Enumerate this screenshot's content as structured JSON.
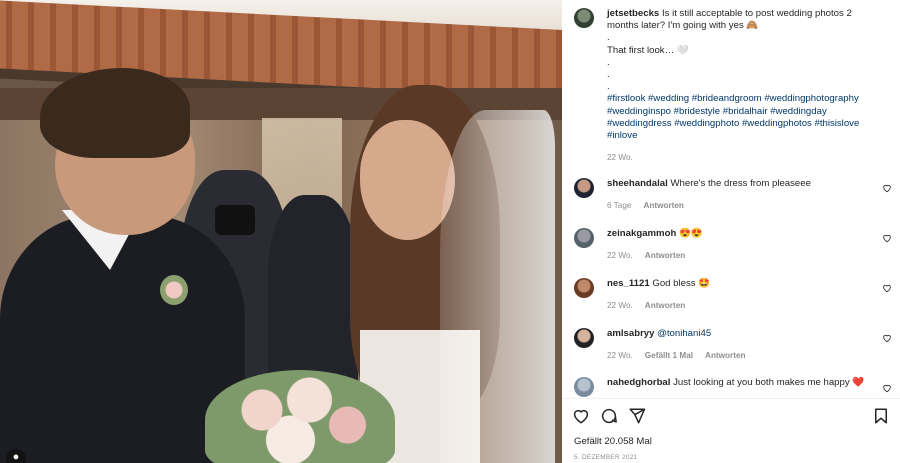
{
  "post": {
    "owner": "jetsetbecks",
    "caption_text": "Is it still acceptable to post wedding photos 2 months later? I'm going with yes 🙈",
    "caption_lines": [
      ".",
      "That first look… 🤍",
      ".",
      ".",
      "."
    ],
    "hashtags": "#firstlook #wedding #brideandgroom #weddingphotography #weddinginspo #bridestyle #bridalhair #weddingday #weddingdress #weddingphoto #weddingphotos #thisislove #inlove",
    "caption_time": "22 Wo."
  },
  "comments": [
    {
      "user": "sheehandalal",
      "text": "Where's the dress from pleaseee",
      "time": "6 Tage",
      "reply": "Antworten",
      "likes": ""
    },
    {
      "user": "zeinakgammoh",
      "text": "😍😍",
      "time": "22 Wo.",
      "reply": "Antworten",
      "likes": ""
    },
    {
      "user": "nes_1121",
      "text": "God bless 🤩",
      "time": "22 Wo.",
      "reply": "Antworten",
      "likes": ""
    },
    {
      "user": "amlsabryy",
      "text": "@tonihani45",
      "time": "22 Wo.",
      "reply": "Antworten",
      "likes": "Gefällt 1 Mal"
    },
    {
      "user": "nahedghorbal",
      "text": "Just looking at you both makes me happy ❤️",
      "time": "",
      "reply": "",
      "likes": ""
    }
  ],
  "footer": {
    "likes": "Gefällt 20.058 Mal",
    "date": "5. DEZEMBER 2021"
  },
  "photo": {
    "user_tag_icon": "person-icon"
  }
}
